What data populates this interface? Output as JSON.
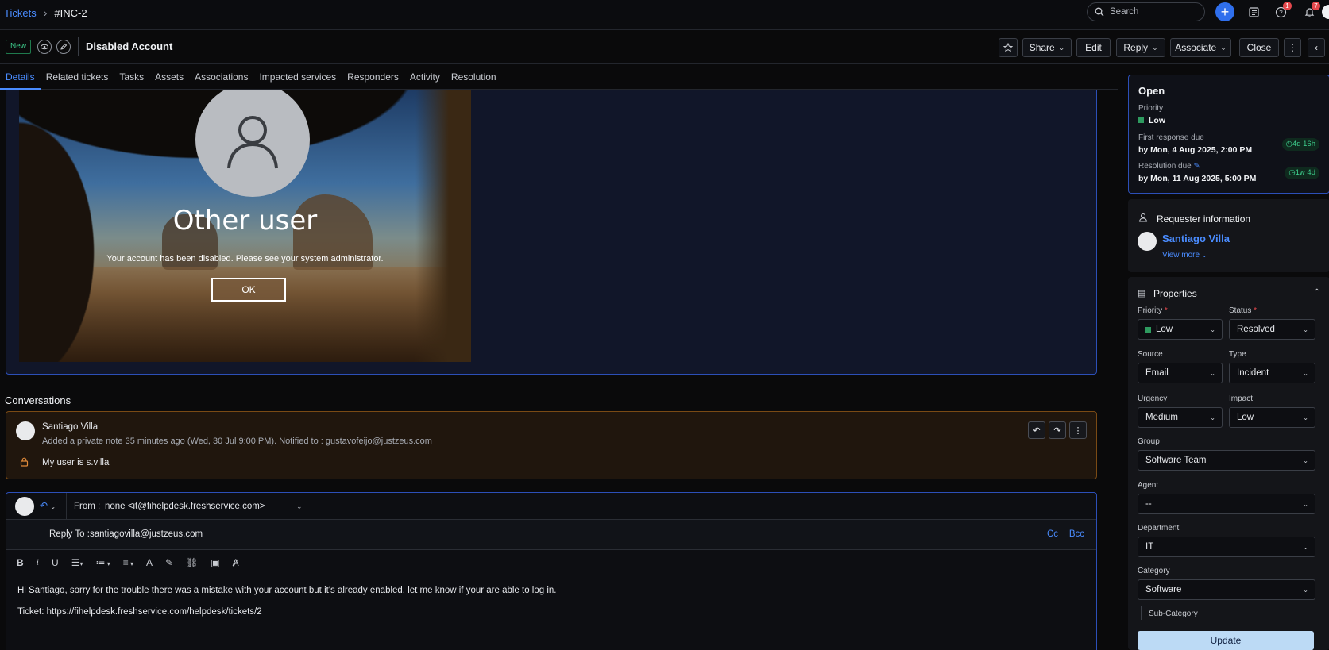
{
  "topbar": {
    "breadcrumb_root": "Tickets",
    "breadcrumb_sep": "›",
    "ticket_id": "#INC-2",
    "search_placeholder": "Search",
    "help_badge": "1",
    "notif_badge": "7"
  },
  "subbar": {
    "status_tag": "New",
    "title": "Disabled Account",
    "actions": {
      "share": "Share",
      "edit": "Edit",
      "reply": "Reply",
      "associate": "Associate",
      "close": "Close"
    }
  },
  "tabs": [
    "Details",
    "Related tickets",
    "Tasks",
    "Assets",
    "Associations",
    "Impacted services",
    "Responders",
    "Activity",
    "Resolution"
  ],
  "description_image": {
    "user_label": "Other user",
    "message": "Your account has been disabled.  Please see your system administrator.",
    "ok_label": "OK"
  },
  "conversations": {
    "title": "Conversations",
    "note": {
      "author": "Santiago Villa",
      "meta": "Added a private note 35 minutes ago (Wed, 30 Jul 9:00 PM). Notified to : gustavofeijo@justzeus.com",
      "text": "My user is s.villa"
    }
  },
  "reply": {
    "from_label": "From :",
    "from_value": "none <it@fihelpdesk.freshservice.com>",
    "reply_to_label": "Reply To :",
    "reply_to_value": "santiagovilla@justzeus.com",
    "cc": "Cc",
    "bcc": "Bcc",
    "body_line1": "Hi Santiago, sorry for the trouble there was a mistake with your account but it's already enabled, let me know if your are able to log in.",
    "body_line2": "Ticket: https://fihelpdesk.freshservice.com/helpdesk/tickets/2"
  },
  "status_card": {
    "title": "Open",
    "priority_label": "Priority",
    "priority_value": "Low",
    "first_response_label": "First response due",
    "first_response_value": "by Mon, 4 Aug 2025, 2:00 PM",
    "first_response_pill": "4d 16h",
    "resolution_label": "Resolution due",
    "resolution_value": "by Mon, 11 Aug 2025, 5:00 PM",
    "resolution_pill": "1w 4d"
  },
  "requester": {
    "title": "Requester information",
    "name": "Santiago Villa",
    "view_more": "View more"
  },
  "properties": {
    "title": "Properties",
    "priority_label": "Priority",
    "priority_value": "Low",
    "status_label": "Status",
    "status_value": "Resolved",
    "source_label": "Source",
    "source_value": "Email",
    "type_label": "Type",
    "type_value": "Incident",
    "urgency_label": "Urgency",
    "urgency_value": "Medium",
    "impact_label": "Impact",
    "impact_value": "Low",
    "group_label": "Group",
    "group_value": "Software Team",
    "agent_label": "Agent",
    "agent_value": "--",
    "department_label": "Department",
    "department_value": "IT",
    "category_label": "Category",
    "category_value": "Software",
    "subcategory_label": "Sub-Category",
    "update_label": "Update"
  },
  "colors": {
    "accent": "#4a8cff",
    "brand_button": "#2f6fed",
    "status_green": "#3ecf8e",
    "note_border": "#7a4a14",
    "update_button": "#bcdaf5"
  }
}
